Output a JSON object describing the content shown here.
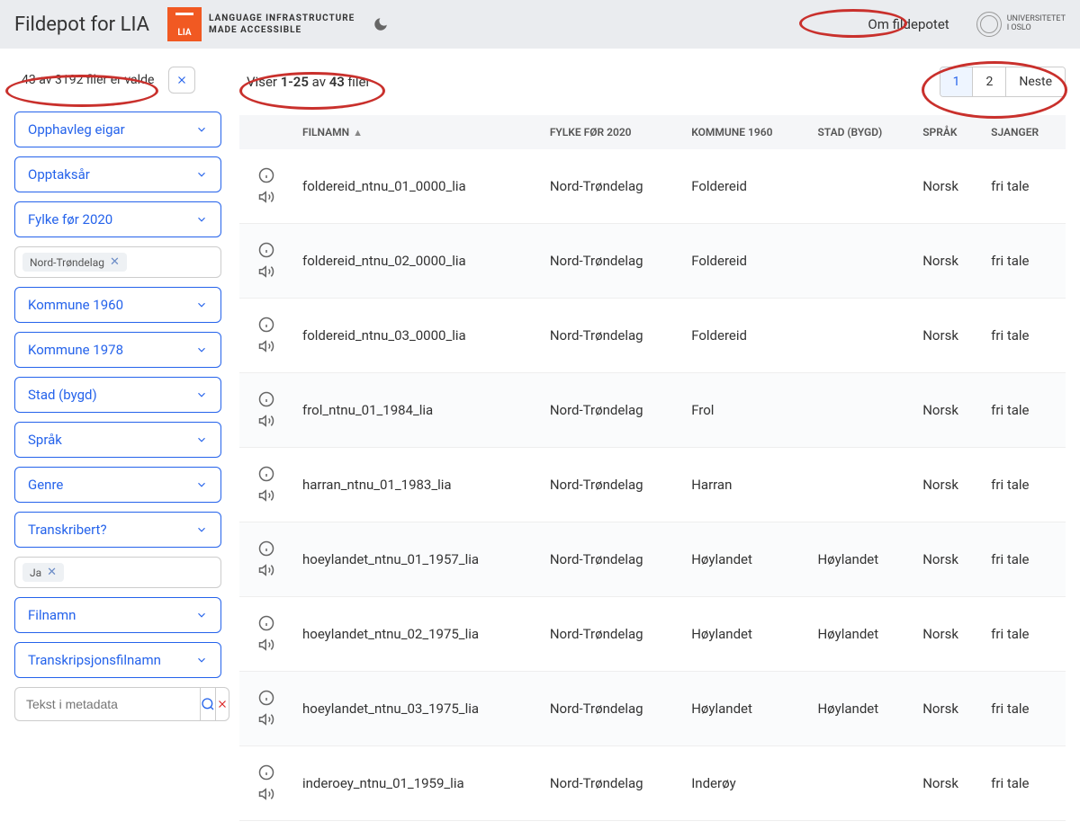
{
  "header": {
    "title": "Fildepot for LIA",
    "logo_text": "LIA",
    "tagline1": "Language Infrastructure",
    "tagline2": "made Accessible",
    "about_link": "Om fildepotet",
    "uio1": "UNIVERSITETET",
    "uio2": "I OSLO"
  },
  "selection": {
    "text": "43 av 3192 filer er valde"
  },
  "showing": {
    "prefix": "Viser ",
    "range": "1-25",
    "mid": " av ",
    "total": "43",
    "suffix": " filer"
  },
  "pagination": {
    "p1": "1",
    "p2": "2",
    "next": "Neste"
  },
  "filters": [
    {
      "label": "Opphavleg eigar"
    },
    {
      "label": "Opptaksår"
    },
    {
      "label": "Fylke før 2020"
    },
    {
      "label": "Kommune 1960"
    },
    {
      "label": "Kommune 1978"
    },
    {
      "label": "Stad (bygd)"
    },
    {
      "label": "Språk"
    },
    {
      "label": "Genre"
    },
    {
      "label": "Transkribert?"
    },
    {
      "label": "Filnamn"
    },
    {
      "label": "Transkripsjonsfilnamn"
    }
  ],
  "chips": {
    "fylke": "Nord-Trøndelag",
    "transkribert": "Ja"
  },
  "search": {
    "placeholder": "Tekst i metadata"
  },
  "columns": {
    "filnamn": "Filnamn",
    "fylke": "Fylke før 2020",
    "kommune": "Kommune 1960",
    "stad": "Stad (bygd)",
    "sprak": "Språk",
    "sjanger": "Sjanger"
  },
  "rows": [
    {
      "filnamn": "foldereid_ntnu_01_0000_lia",
      "fylke": "Nord-Trøndelag",
      "kommune": "Foldereid",
      "stad": "",
      "sprak": "Norsk",
      "sjanger": "fri tale"
    },
    {
      "filnamn": "foldereid_ntnu_02_0000_lia",
      "fylke": "Nord-Trøndelag",
      "kommune": "Foldereid",
      "stad": "",
      "sprak": "Norsk",
      "sjanger": "fri tale"
    },
    {
      "filnamn": "foldereid_ntnu_03_0000_lia",
      "fylke": "Nord-Trøndelag",
      "kommune": "Foldereid",
      "stad": "",
      "sprak": "Norsk",
      "sjanger": "fri tale"
    },
    {
      "filnamn": "frol_ntnu_01_1984_lia",
      "fylke": "Nord-Trøndelag",
      "kommune": "Frol",
      "stad": "",
      "sprak": "Norsk",
      "sjanger": "fri tale"
    },
    {
      "filnamn": "harran_ntnu_01_1983_lia",
      "fylke": "Nord-Trøndelag",
      "kommune": "Harran",
      "stad": "",
      "sprak": "Norsk",
      "sjanger": "fri tale"
    },
    {
      "filnamn": "hoeylandet_ntnu_01_1957_lia",
      "fylke": "Nord-Trøndelag",
      "kommune": "Høylandet",
      "stad": "Høylandet",
      "sprak": "Norsk",
      "sjanger": "fri tale"
    },
    {
      "filnamn": "hoeylandet_ntnu_02_1975_lia",
      "fylke": "Nord-Trøndelag",
      "kommune": "Høylandet",
      "stad": "Høylandet",
      "sprak": "Norsk",
      "sjanger": "fri tale"
    },
    {
      "filnamn": "hoeylandet_ntnu_03_1975_lia",
      "fylke": "Nord-Trøndelag",
      "kommune": "Høylandet",
      "stad": "Høylandet",
      "sprak": "Norsk",
      "sjanger": "fri tale"
    },
    {
      "filnamn": "inderoey_ntnu_01_1959_lia",
      "fylke": "Nord-Trøndelag",
      "kommune": "Inderøy",
      "stad": "",
      "sprak": "Norsk",
      "sjanger": "fri tale"
    }
  ]
}
